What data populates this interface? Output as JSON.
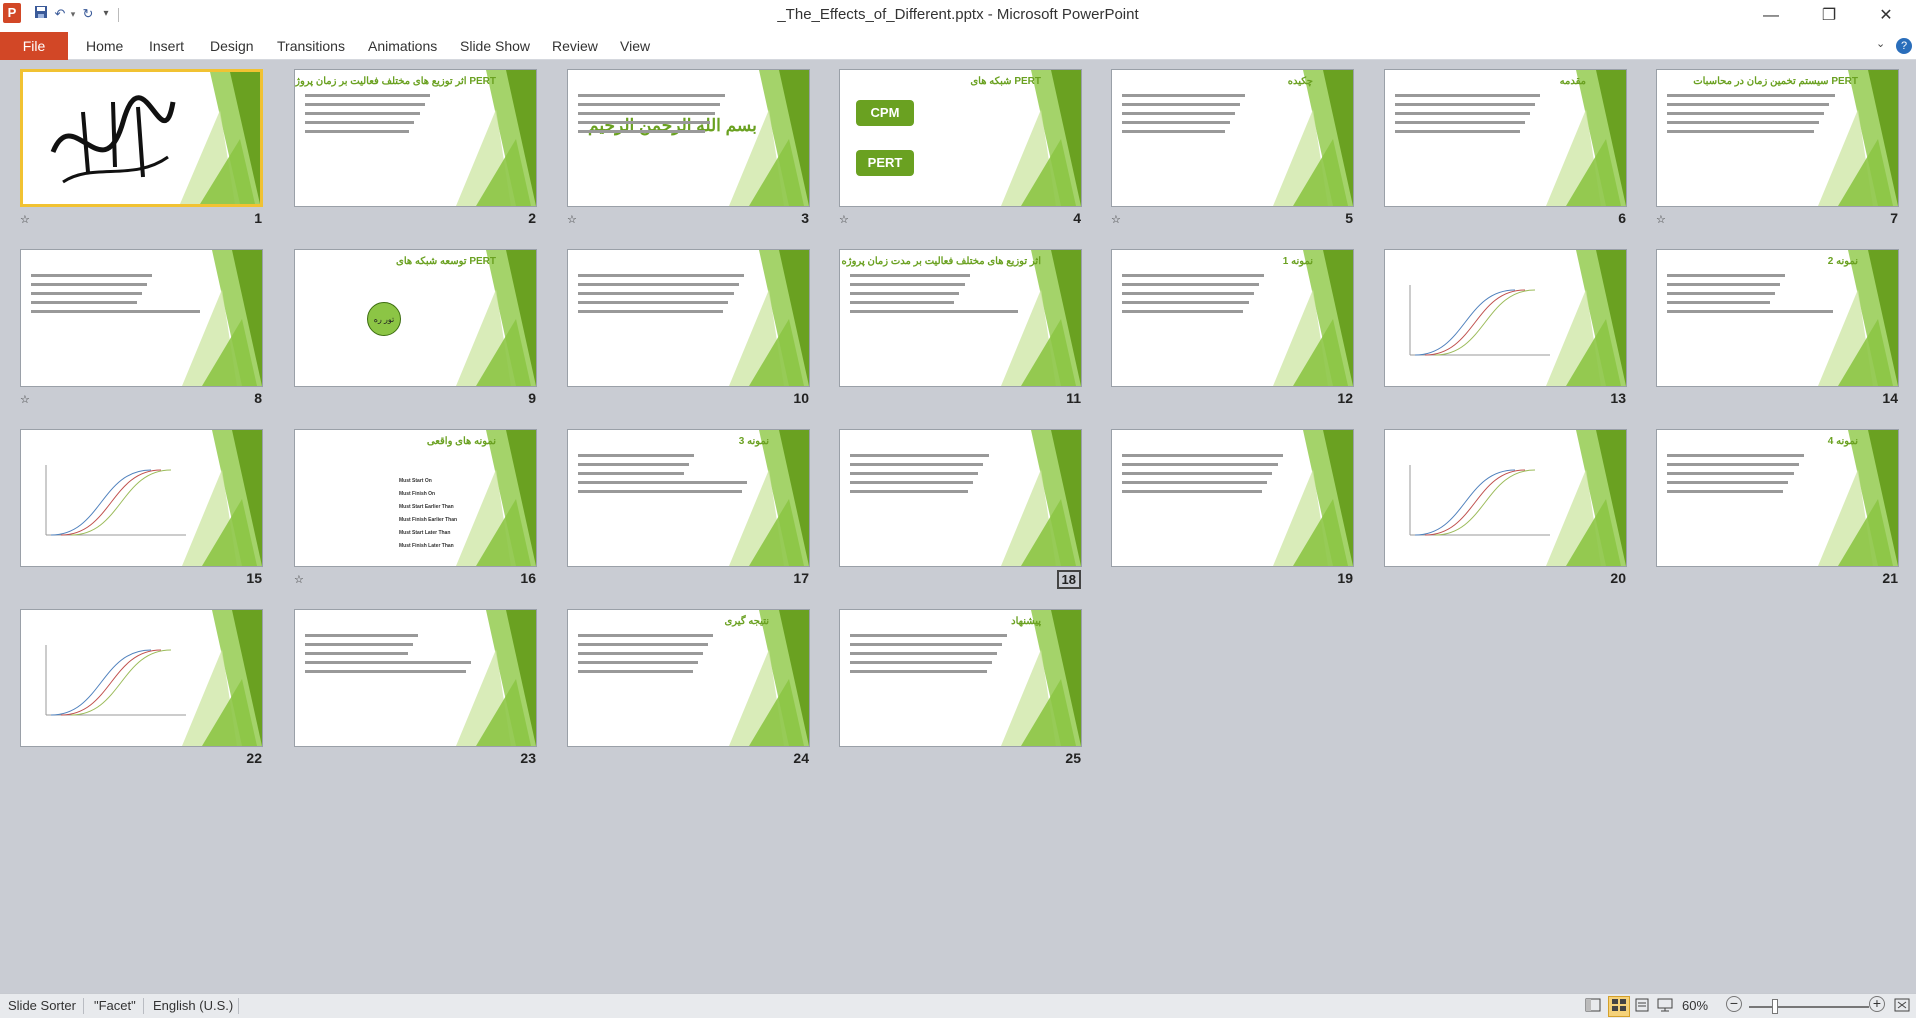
{
  "titlebar": {
    "title": "_The_Effects_of_Different.pptx  -  Microsoft PowerPoint",
    "app_icon": "P",
    "save_icon": "floppy-disk-icon",
    "undo_icon": "undo-icon",
    "redo_icon": "repeat-icon",
    "qat_menu_icon": "customize-qat-icon",
    "minimize": "—",
    "restore": "❐",
    "close": "✕"
  },
  "ribbon": {
    "file": "File",
    "tabs": [
      "Home",
      "Insert",
      "Design",
      "Transitions",
      "Animations",
      "Slide Show",
      "Review",
      "View"
    ]
  },
  "slides": [
    {
      "n": "1",
      "title": "",
      "star": true,
      "selected": true
    },
    {
      "n": "2",
      "title": "اثر توزیع های مختلف فعالیت بر زمان پروژه در شبکه های PERT",
      "star": false
    },
    {
      "n": "3",
      "title": "بسم الله الرحمن الرحیم",
      "star": true
    },
    {
      "n": "4",
      "title": "شبکه های PERT",
      "star": true
    },
    {
      "n": "5",
      "title": "چکیده",
      "star": true
    },
    {
      "n": "6",
      "title": "مقدمه",
      "star": false
    },
    {
      "n": "7",
      "title": "سیستم تخمین زمان در محاسبات PERT",
      "star": true
    },
    {
      "n": "8",
      "title": "",
      "star": true
    },
    {
      "n": "9",
      "title": "توسعه شبکه های PERT",
      "star": false
    },
    {
      "n": "10",
      "title": "",
      "star": false
    },
    {
      "n": "11",
      "title": "اثر توزیع های مختلف فعالیت بر مدت زمان پروژه",
      "star": false
    },
    {
      "n": "12",
      "title": "نمونه 1",
      "star": false
    },
    {
      "n": "13",
      "title": "",
      "star": false
    },
    {
      "n": "14",
      "title": "نمونه 2",
      "star": false
    },
    {
      "n": "15",
      "title": "",
      "star": false
    },
    {
      "n": "16",
      "title": "نمونه های واقعی",
      "star": true
    },
    {
      "n": "17",
      "title": "نمونه 3",
      "star": false
    },
    {
      "n": "18",
      "title": "",
      "star": false,
      "boxed": true
    },
    {
      "n": "19",
      "title": "",
      "star": false
    },
    {
      "n": "20",
      "title": "",
      "star": false
    },
    {
      "n": "21",
      "title": "نمونه 4",
      "star": false
    },
    {
      "n": "22",
      "title": "",
      "star": false
    },
    {
      "n": "23",
      "title": "",
      "star": false
    },
    {
      "n": "24",
      "title": "نتیجه گیری",
      "star": false
    },
    {
      "n": "25",
      "title": "پیشنهاد",
      "star": false
    }
  ],
  "slide_content": {
    "s4_cpm": "CPM",
    "s4_pert": "PERT",
    "s9_bubble": "تور ره",
    "s16_items": [
      "Must Start On",
      "Must Finish On",
      "Must Start Earlier Than",
      "Must Finish Earlier Than",
      "Must Start Later Than",
      "Must Finish Later Than"
    ]
  },
  "statusbar": {
    "view": "Slide Sorter",
    "theme": "\"Facet\"",
    "language": "English (U.S.)",
    "zoom": "60%"
  },
  "colors": {
    "accent": "#d24726",
    "green": "#6aa121",
    "green_light": "#a4d36a"
  }
}
